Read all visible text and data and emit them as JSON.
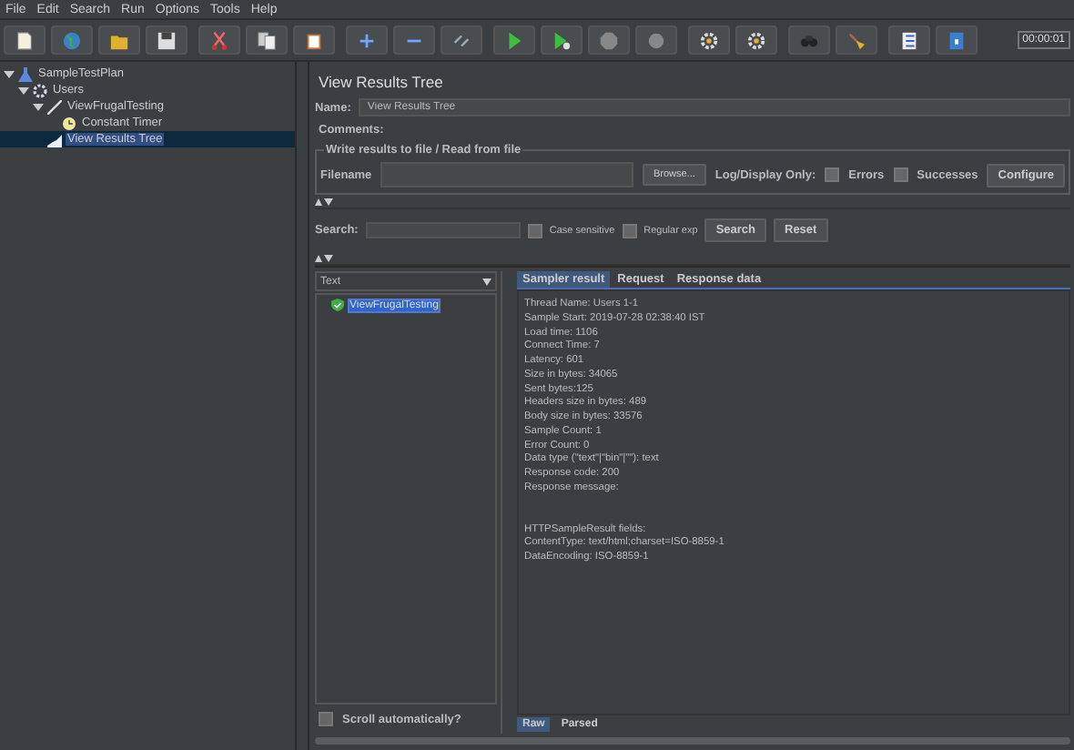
{
  "menu": [
    "File",
    "Edit",
    "Search",
    "Run",
    "Options",
    "Tools",
    "Help"
  ],
  "toolbar": {
    "groups": [
      [
        {
          "kind": "document"
        },
        {
          "kind": "globe"
        },
        {
          "kind": "folder"
        },
        {
          "kind": "save"
        }
      ],
      [
        {
          "kind": "scissors"
        },
        {
          "kind": "copy"
        },
        {
          "kind": "clipboard"
        }
      ],
      [
        {
          "kind": "plus"
        },
        {
          "kind": "minus"
        },
        {
          "kind": "toggle"
        }
      ],
      [
        {
          "kind": "play"
        },
        {
          "kind": "play-dot"
        },
        {
          "kind": "octagon"
        },
        {
          "kind": "circle"
        }
      ],
      [
        {
          "kind": "gear"
        },
        {
          "kind": "gear"
        }
      ],
      [
        {
          "kind": "binoculars"
        },
        {
          "kind": "broom"
        }
      ],
      [
        {
          "kind": "list"
        },
        {
          "kind": "book"
        }
      ]
    ],
    "timer": "00:00:01"
  },
  "tree": [
    {
      "label": "SampleTestPlan",
      "kind": "flask",
      "expanded": true,
      "selected": false,
      "children": [
        {
          "label": "Users",
          "kind": "gear",
          "expanded": true,
          "selected": false,
          "children": [
            {
              "label": "ViewFrugalTesting",
              "kind": "pen",
              "expanded": true,
              "selected": false,
              "children": [
                {
                  "label": "Constant Timer",
                  "kind": "clock",
                  "selected": false
                }
              ]
            },
            {
              "label": "View Results Tree",
              "kind": "chart",
              "selected": true
            }
          ]
        }
      ]
    }
  ],
  "panel": {
    "title": "View Results Tree",
    "name_label": "Name:",
    "name_value": "View Results Tree",
    "comments_label": "Comments:",
    "file_group": {
      "legend": "Write results to file / Read from file",
      "filename_label": "Filename",
      "browse": "Browse...",
      "log_label": "Log/Display Only:",
      "options": [
        {
          "label": "Errors",
          "checked": false
        },
        {
          "label": "Successes",
          "checked": false
        }
      ],
      "configure": "Configure"
    },
    "search": {
      "label": "Search:",
      "options": [
        {
          "label": "Case sensitive",
          "checked": false
        },
        {
          "label": "Regular exp",
          "checked": false
        }
      ],
      "search_button": "Search",
      "reset_button": "Reset"
    },
    "renderer": "Text",
    "results": [
      {
        "label": "ViewFrugalTesting",
        "selected": true
      }
    ],
    "scroll_auto": {
      "label": "Scroll automatically?",
      "checked": false
    },
    "tabs": [
      {
        "label": "Sampler result",
        "selected": true
      },
      {
        "label": "Request",
        "selected": false
      },
      {
        "label": "Response data",
        "selected": false
      }
    ],
    "lines": [
      "Thread Name: Users 1-1",
      "Sample Start: 2019-07-28 02:38:40 IST",
      "Load time: 1106",
      "Connect Time: 7",
      "Latency: 601",
      "Size in bytes: 34065",
      "Sent bytes:125",
      "Headers size in bytes: 489",
      "Body size in bytes: 33576",
      "Sample Count: 1",
      "Error Count: 0",
      "Data type (\"text\"|\"bin\"|\"\"): text",
      "Response code: 200",
      "Response message:"
    ],
    "fields_lines": [
      "HTTPSampleResult fields:",
      "ContentType: text/html;charset=ISO-8859-1",
      "DataEncoding: ISO-8859-1"
    ],
    "bottom_tabs": [
      {
        "label": "Raw",
        "selected": true
      },
      {
        "label": "Parsed",
        "selected": false
      }
    ]
  }
}
